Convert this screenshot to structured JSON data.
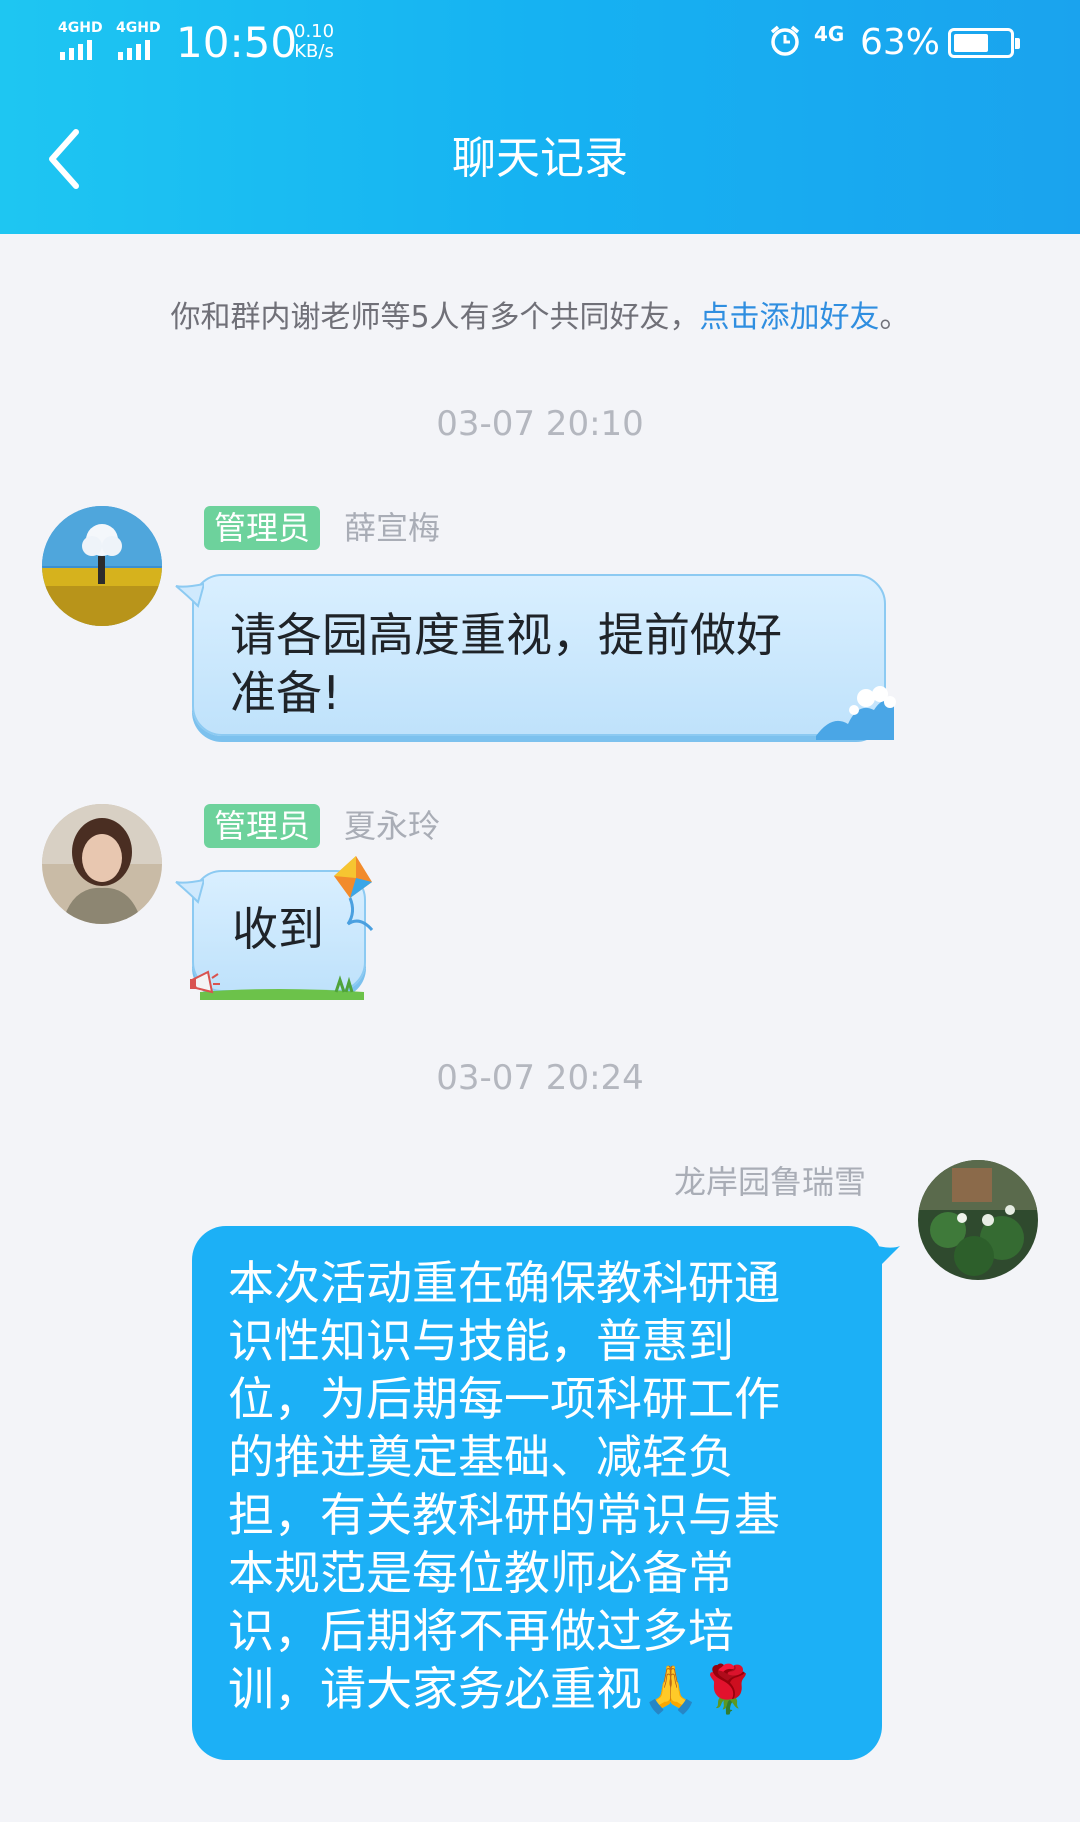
{
  "status_bar": {
    "sim1_label": "4GHD",
    "sim2_label": "4GHD",
    "time": "10:50",
    "speed_value": "0.10",
    "speed_unit": "KB/s",
    "alarm_icon": "alarm-clock-icon",
    "network": "4G",
    "battery_percent": "63%",
    "battery_level": 0.63
  },
  "header": {
    "title": "聊天记录",
    "back_icon": "chevron-left-icon"
  },
  "notice": {
    "text": "你和群内谢老师等5人有多个共同好友，",
    "link": "点击添加好友",
    "suffix": "。"
  },
  "messages": [
    {
      "timestamp": "03-07 20:10",
      "badge": "管理员",
      "sender": "薛宣梅",
      "text": "请各园高度重视，提前做好\n准备!"
    },
    {
      "badge": "管理员",
      "sender": "夏永玲",
      "text": "收到"
    },
    {
      "timestamp": "03-07 20:24",
      "sender": "龙岸园鲁瑞雪",
      "text": "本次活动重在确保教科研通\n识性知识与技能，普惠到\n位，为后期每一项科研工作\n的推进奠定基础、减轻负\n担，有关教科研的常识与基\n本规范是每位教师必备常\n识，后期将不再做过多培\n训，请大家务必重视🙏🌹"
    }
  ],
  "colors": {
    "header_gradient_start": "#1ec6f2",
    "header_gradient_end": "#1aa3ee",
    "outgoing_bubble": "#1cb0f6",
    "badge": "#6dd29c",
    "link": "#2f8ee0"
  }
}
